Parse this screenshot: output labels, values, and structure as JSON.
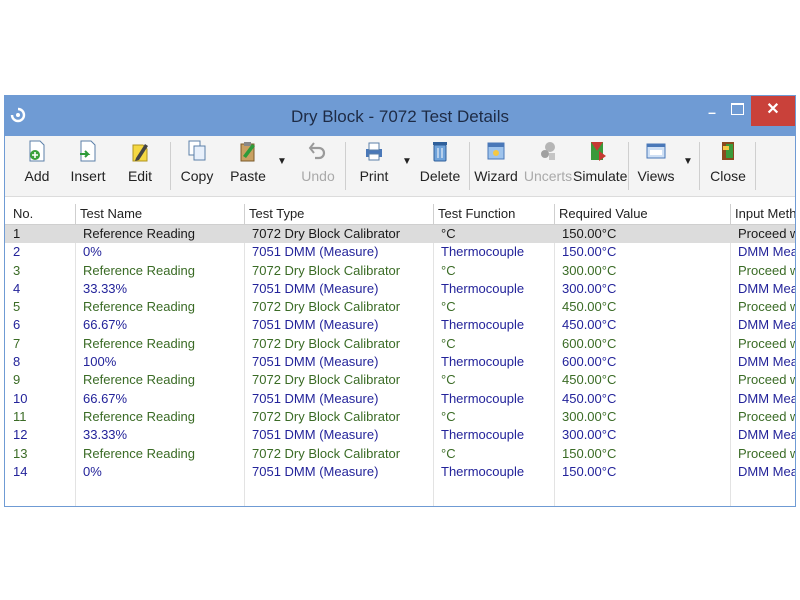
{
  "window": {
    "title": "Dry Block - 7072 Test Details",
    "minimize_glyph": "–",
    "close_glyph": "✕"
  },
  "toolbar": {
    "add": "Add",
    "insert": "Insert",
    "edit": "Edit",
    "copy": "Copy",
    "paste": "Paste",
    "undo": "Undo",
    "print": "Print",
    "delete": "Delete",
    "wizard": "Wizard",
    "uncerts": "Uncerts",
    "simulate": "Simulate",
    "views": "Views",
    "close": "Close",
    "icons": [
      "add-icon",
      "insert-icon",
      "edit-icon",
      "copy-icon",
      "paste-icon",
      "undo-icon",
      "print-icon",
      "delete-icon",
      "wizard-icon",
      "uncerts-icon",
      "simulate-icon",
      "views-icon",
      "close-door-icon"
    ]
  },
  "grid": {
    "headers": [
      "No.",
      "Test Name",
      "Test Type",
      "Test Function",
      "Required Value",
      "Input Meth"
    ],
    "rows": [
      [
        "1",
        "Reference Reading",
        "7072 Dry Block Calibrator",
        "°C",
        "150.00°C",
        "Proceed wi"
      ],
      [
        "2",
        "0%",
        "7051 DMM (Measure)",
        "Thermocouple",
        "150.00°C",
        "DMM Meas"
      ],
      [
        "3",
        "Reference Reading",
        "7072 Dry Block Calibrator",
        "°C",
        "300.00°C",
        "Proceed wi"
      ],
      [
        "4",
        "33.33%",
        "7051 DMM (Measure)",
        "Thermocouple",
        "300.00°C",
        "DMM Meas"
      ],
      [
        "5",
        "Reference Reading",
        "7072 Dry Block Calibrator",
        "°C",
        "450.00°C",
        "Proceed wi"
      ],
      [
        "6",
        "66.67%",
        "7051 DMM (Measure)",
        "Thermocouple",
        "450.00°C",
        "DMM Meas"
      ],
      [
        "7",
        "Reference Reading",
        "7072 Dry Block Calibrator",
        "°C",
        "600.00°C",
        "Proceed wi"
      ],
      [
        "8",
        "100%",
        "7051 DMM (Measure)",
        "Thermocouple",
        "600.00°C",
        "DMM Meas"
      ],
      [
        "9",
        "Reference Reading",
        "7072 Dry Block Calibrator",
        "°C",
        "450.00°C",
        "Proceed wi"
      ],
      [
        "10",
        "66.67%",
        "7051 DMM (Measure)",
        "Thermocouple",
        "450.00°C",
        "DMM Meas"
      ],
      [
        "11",
        "Reference Reading",
        "7072 Dry Block Calibrator",
        "°C",
        "300.00°C",
        "Proceed wi"
      ],
      [
        "12",
        "33.33%",
        "7051 DMM (Measure)",
        "Thermocouple",
        "300.00°C",
        "DMM Meas"
      ],
      [
        "13",
        "Reference Reading",
        "7072 Dry Block Calibrator",
        "°C",
        "150.00°C",
        "Proceed wi"
      ],
      [
        "14",
        "0%",
        "7051 DMM (Measure)",
        "Thermocouple",
        "150.00°C",
        "DMM Meas"
      ]
    ]
  },
  "colors": {
    "titlebar": "#6f9bd4",
    "close_button": "#c9413a",
    "reference_row_text": "#3a6b25",
    "dmm_row_text": "#23239a",
    "selected_row": "#dcdcdc"
  }
}
